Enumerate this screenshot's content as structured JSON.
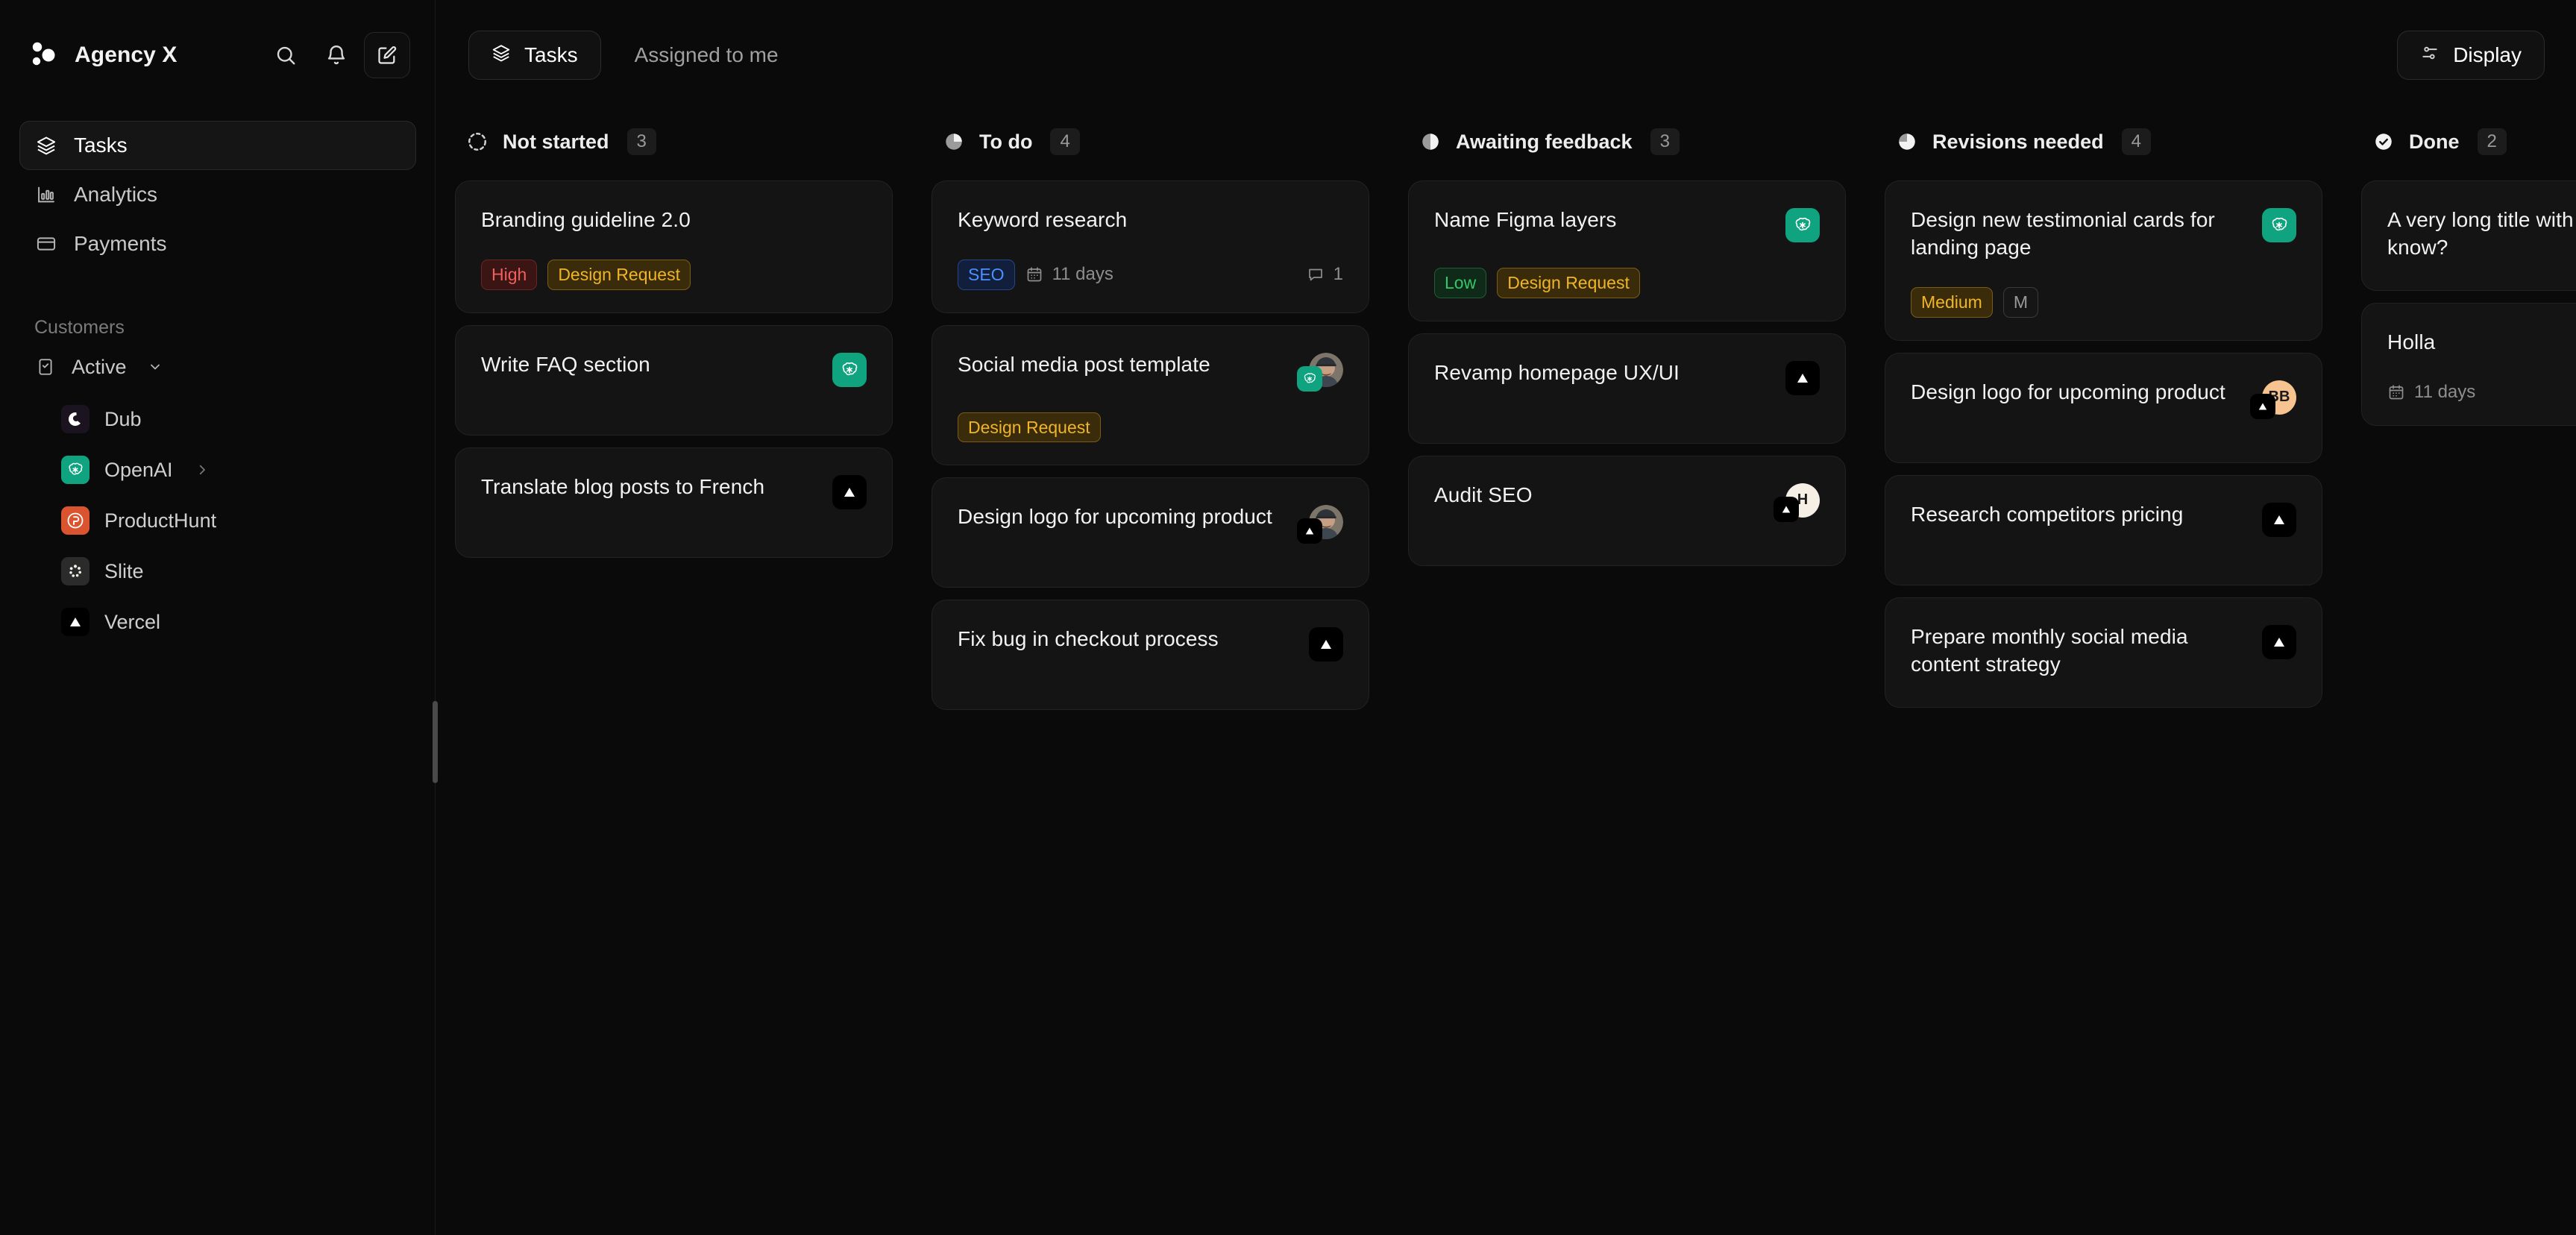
{
  "brand": {
    "name": "Agency X",
    "logo_icon": "agency-x-logo"
  },
  "sidebar": {
    "actions": [
      {
        "icon": "search-icon",
        "name": "search-button"
      },
      {
        "icon": "bell-icon",
        "name": "notifications-button"
      },
      {
        "icon": "compose-icon",
        "name": "compose-button"
      }
    ],
    "nav": [
      {
        "label": "Tasks",
        "icon": "layers-icon",
        "active": true
      },
      {
        "label": "Analytics",
        "icon": "bar-chart-icon",
        "active": false
      },
      {
        "label": "Payments",
        "icon": "credit-card-icon",
        "active": false
      }
    ],
    "section_label": "Customers",
    "group": {
      "label": "Active",
      "icon": "checklist-icon",
      "caret": "chevron-down-icon"
    },
    "customers": [
      {
        "label": "Dub",
        "logo": "dub-logo",
        "has_chevron": false
      },
      {
        "label": "OpenAI",
        "logo": "openai-logo",
        "has_chevron": true
      },
      {
        "label": "ProductHunt",
        "logo": "producthunt-logo",
        "has_chevron": false
      },
      {
        "label": "Slite",
        "logo": "slite-logo",
        "has_chevron": false
      },
      {
        "label": "Vercel",
        "logo": "vercel-logo",
        "has_chevron": false
      }
    ]
  },
  "topbar": {
    "tabs": [
      {
        "label": "Tasks",
        "icon": "layers-icon",
        "active": true
      },
      {
        "label": "Assigned to me",
        "icon": "",
        "active": false
      }
    ],
    "display_button": {
      "label": "Display",
      "icon": "sliders-icon"
    }
  },
  "board": {
    "columns": [
      {
        "title": "Not started",
        "count": "3",
        "icon": "dashed-circle-icon",
        "cards": [
          {
            "title": "Branding guideline 2.0",
            "tags": [
              {
                "label": "High",
                "color": "#f25f5c",
                "bg": "#3a1514",
                "border": "#6d2422"
              },
              {
                "label": "Design Request",
                "color": "#f0b429",
                "bg": "#3a2c0b",
                "border": "#7a5c17"
              }
            ],
            "avatar": null,
            "badge": null,
            "due": null,
            "comments": null
          },
          {
            "title": "Write FAQ section",
            "tags": [],
            "avatar": {
              "type": "logo",
              "logo": "openai-logo"
            },
            "badge": null,
            "due": null,
            "comments": null
          },
          {
            "title": "Translate blog posts to French",
            "tags": [],
            "avatar": {
              "type": "logo",
              "logo": "vercel-logo"
            },
            "badge": null,
            "due": null,
            "comments": null
          }
        ]
      },
      {
        "title": "To do",
        "count": "4",
        "icon": "quarter-pie-icon",
        "cards": [
          {
            "title": "Keyword research",
            "tags": [
              {
                "label": "SEO",
                "color": "#4a90ff",
                "bg": "#111f3d",
                "border": "#25458a"
              }
            ],
            "avatar": null,
            "badge": null,
            "due": "11 days",
            "comments": "1"
          },
          {
            "title": "Social media post template",
            "tags": [
              {
                "label": "Design Request",
                "color": "#f0b429",
                "bg": "#3a2c0b",
                "border": "#7a5c17"
              }
            ],
            "avatar": {
              "type": "photo",
              "tone": "#8a8074"
            },
            "badge": {
              "logo": "openai-logo"
            },
            "due": null,
            "comments": null
          },
          {
            "title": "Design logo for upcoming product",
            "tags": [],
            "avatar": {
              "type": "photo",
              "tone": "#8a8074"
            },
            "badge": {
              "logo": "vercel-logo"
            },
            "due": null,
            "comments": null
          },
          {
            "title": "Fix bug in checkout process",
            "tags": [],
            "avatar": {
              "type": "logo",
              "logo": "vercel-logo"
            },
            "badge": null,
            "due": null,
            "comments": null
          }
        ]
      },
      {
        "title": "Awaiting feedback",
        "count": "3",
        "icon": "half-pie-icon",
        "cards": [
          {
            "title": "Name Figma layers",
            "tags": [
              {
                "label": "Low",
                "color": "#35c76a",
                "bg": "#0f2a19",
                "border": "#1f5e36"
              },
              {
                "label": "Design Request",
                "color": "#f0b429",
                "bg": "#3a2c0b",
                "border": "#7a5c17"
              }
            ],
            "avatar": {
              "type": "logo",
              "logo": "openai-logo"
            },
            "badge": null,
            "due": null,
            "comments": null
          },
          {
            "title": "Revamp homepage UX/UI",
            "tags": [],
            "avatar": {
              "type": "logo",
              "logo": "vercel-logo"
            },
            "badge": null,
            "due": null,
            "comments": null
          },
          {
            "title": "Audit SEO",
            "tags": [],
            "avatar": {
              "type": "initials",
              "initials": "H",
              "bg": "#f6efe6"
            },
            "badge": {
              "logo": "vercel-logo"
            },
            "due": null,
            "comments": null
          }
        ]
      },
      {
        "title": "Revisions needed",
        "count": "4",
        "icon": "three-quarter-pie-icon",
        "cards": [
          {
            "title": "Design new testimonial cards for landing page",
            "tags": [
              {
                "label": "Medium",
                "color": "#f0b429",
                "bg": "#3a2c0b",
                "border": "#7a5c17"
              },
              {
                "label": "M",
                "color": "#9a9a9a",
                "bg": "#161616",
                "border": "#3a3a3a"
              }
            ],
            "avatar": {
              "type": "logo",
              "logo": "openai-logo"
            },
            "badge": null,
            "due": null,
            "comments": null
          },
          {
            "title": "Design logo for upcoming product",
            "tags": [],
            "avatar": {
              "type": "initials",
              "initials": "BB",
              "bg": "#f6c391"
            },
            "badge": {
              "logo": "vercel-logo"
            },
            "due": null,
            "comments": null
          },
          {
            "title": "Research competitors pricing",
            "tags": [],
            "avatar": {
              "type": "logo",
              "logo": "vercel-logo"
            },
            "badge": null,
            "due": null,
            "comments": null
          },
          {
            "title": "Prepare monthly social media content strategy",
            "tags": [],
            "avatar": {
              "type": "logo",
              "logo": "vercel-logo"
            },
            "badge": null,
            "due": null,
            "comments": null
          }
        ]
      },
      {
        "title": "Done",
        "count": "2",
        "icon": "check-circle-icon",
        "cards": [
          {
            "title": "A very long title with a lot of text, you know?",
            "tags": [],
            "avatar": null,
            "badge": null,
            "due": null,
            "comments": null
          },
          {
            "title": "Holla",
            "tags": [],
            "avatar": null,
            "badge": null,
            "due": "11 days",
            "comments": null
          }
        ]
      }
    ]
  }
}
